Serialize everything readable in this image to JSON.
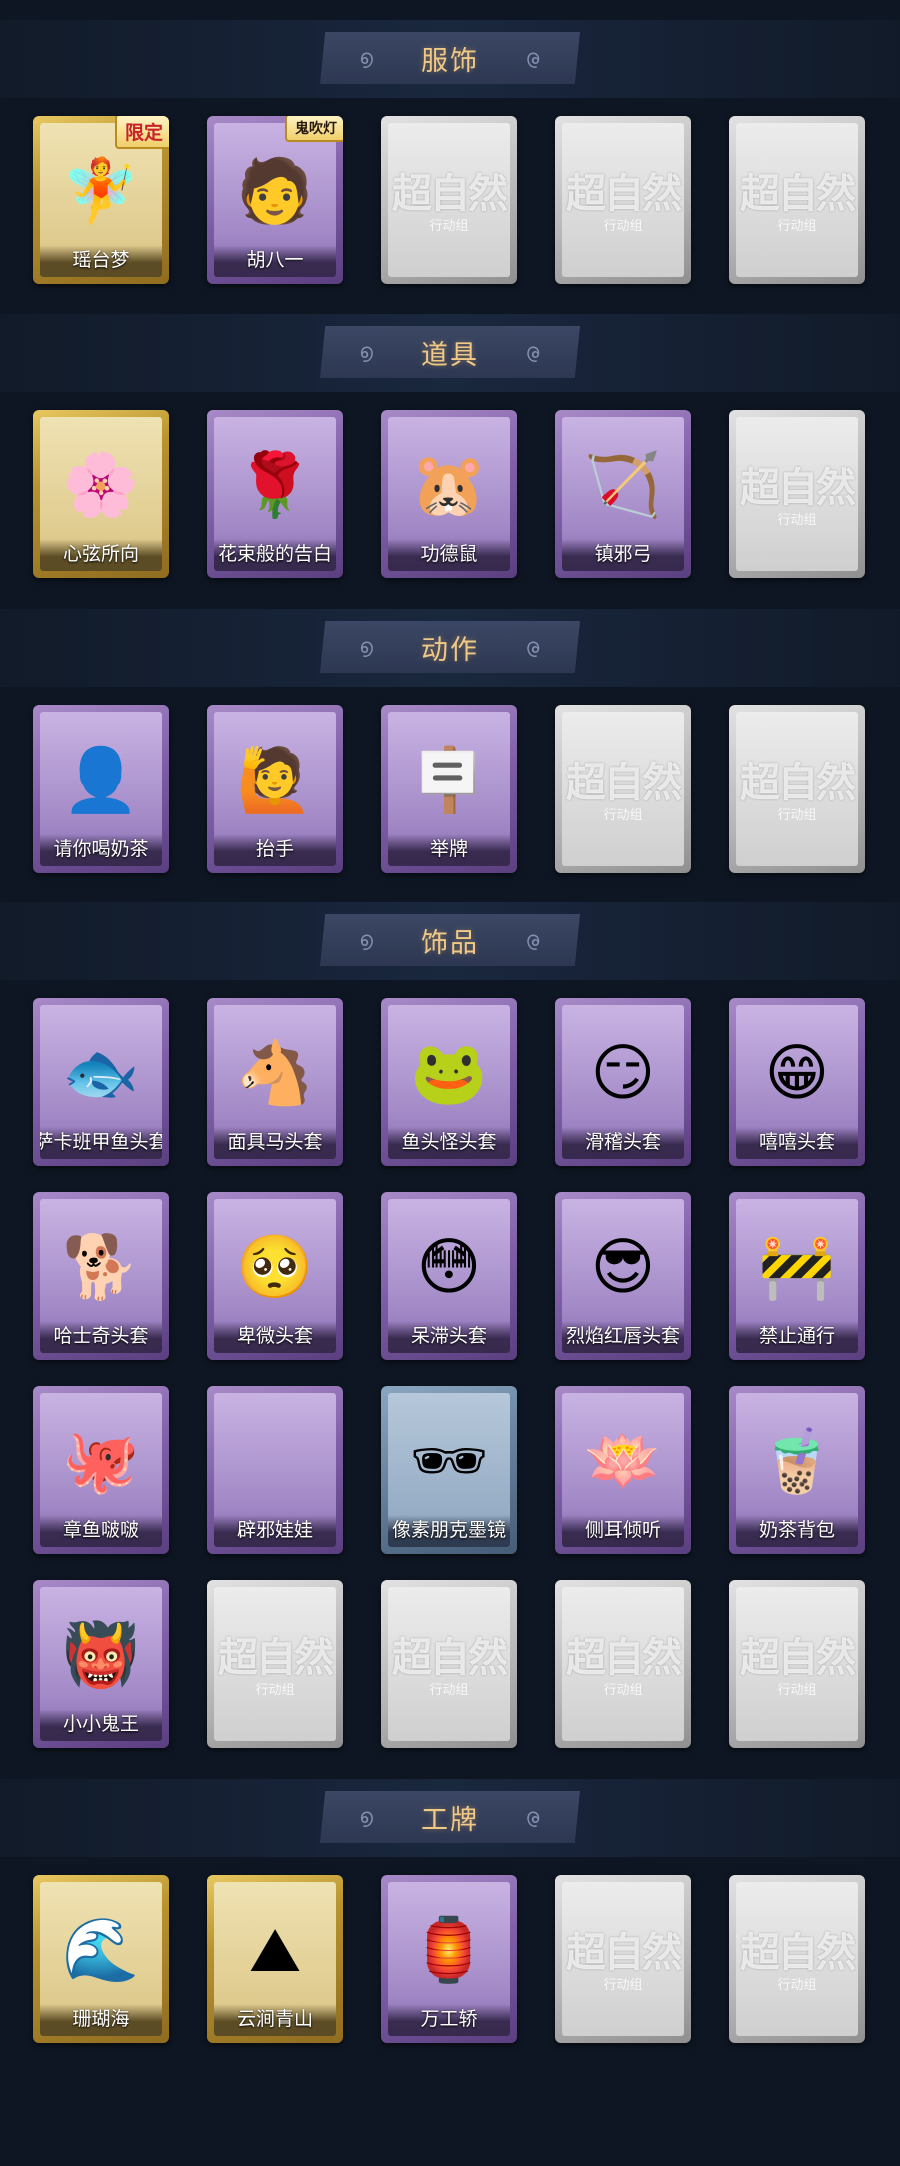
{
  "watermark": {
    "main": "超自然",
    "sub": "行动组"
  },
  "sections": [
    {
      "title": "服饰",
      "cards": [
        {
          "label": "瑶台梦",
          "rarity": "gold",
          "icon": "dress-figure",
          "glyph": "🧚",
          "badge": "限定"
        },
        {
          "label": "胡八一",
          "rarity": "purple",
          "icon": "character-portrait",
          "glyph": "🧑",
          "badge": "鬼吹灯"
        },
        {
          "label": "",
          "rarity": "empty"
        },
        {
          "label": "",
          "rarity": "empty"
        },
        {
          "label": "",
          "rarity": "empty"
        }
      ]
    },
    {
      "title": "道具",
      "cards": [
        {
          "label": "心弦所向",
          "rarity": "gold",
          "icon": "flower-bow",
          "glyph": "🌸"
        },
        {
          "label": "花束般的告白",
          "rarity": "purple",
          "icon": "rose",
          "glyph": "🌹"
        },
        {
          "label": "功德鼠",
          "rarity": "purple",
          "icon": "hamster",
          "glyph": "🐹"
        },
        {
          "label": "镇邪弓",
          "rarity": "purple",
          "icon": "bow",
          "glyph": "🏹"
        },
        {
          "label": "",
          "rarity": "empty"
        }
      ]
    },
    {
      "title": "动作",
      "cards": [
        {
          "label": "请你喝奶茶",
          "rarity": "purple",
          "icon": "person-with-sign",
          "glyph": "👤"
        },
        {
          "label": "抬手",
          "rarity": "purple",
          "icon": "raise-hand",
          "glyph": "🙋"
        },
        {
          "label": "举牌",
          "rarity": "purple",
          "icon": "hold-sign",
          "glyph": "🪧"
        },
        {
          "label": "",
          "rarity": "empty"
        },
        {
          "label": "",
          "rarity": "empty"
        }
      ]
    },
    {
      "title": "饰品",
      "cards": [
        {
          "label": "萨卡班甲鱼头套",
          "rarity": "purple",
          "icon": "fish-head",
          "glyph": "🐟"
        },
        {
          "label": "面具马头套",
          "rarity": "purple",
          "icon": "horse-head",
          "glyph": "🐴"
        },
        {
          "label": "鱼头怪头套",
          "rarity": "purple",
          "icon": "fish-monster",
          "glyph": "🐸"
        },
        {
          "label": "滑稽头套",
          "rarity": "purple",
          "icon": "funny-face",
          "glyph": "😏"
        },
        {
          "label": "嘻嘻头套",
          "rarity": "purple",
          "icon": "grin-face",
          "glyph": "😁"
        },
        {
          "label": "哈士奇头套",
          "rarity": "purple",
          "icon": "husky",
          "glyph": "🐕"
        },
        {
          "label": "卑微头套",
          "rarity": "purple",
          "icon": "humble-face",
          "glyph": "🥺"
        },
        {
          "label": "呆滞头套",
          "rarity": "purple",
          "icon": "dazed-face",
          "glyph": "😳"
        },
        {
          "label": "烈焰红唇头套",
          "rarity": "purple",
          "icon": "pikachu-glasses",
          "glyph": "😎"
        },
        {
          "label": "禁止通行",
          "rarity": "purple",
          "icon": "traffic-cone",
          "glyph": "🚧"
        },
        {
          "label": "章鱼啵啵",
          "rarity": "purple",
          "icon": "octopus",
          "glyph": "🐙"
        },
        {
          "label": "辟邪娃娃",
          "rarity": "purple",
          "icon": "doll",
          "glyph": ""
        },
        {
          "label": "像素朋克墨镜",
          "rarity": "blue",
          "icon": "pixel-sunglasses",
          "glyph": "🕶"
        },
        {
          "label": "侧耳倾听",
          "rarity": "purple",
          "icon": "lotus-wreath",
          "glyph": "🪷"
        },
        {
          "label": "奶茶背包",
          "rarity": "purple",
          "icon": "milk-tea-bag",
          "glyph": "🧋"
        },
        {
          "label": "小小鬼王",
          "rarity": "purple",
          "icon": "chibi-king",
          "glyph": "👹"
        },
        {
          "label": "",
          "rarity": "empty"
        },
        {
          "label": "",
          "rarity": "empty"
        },
        {
          "label": "",
          "rarity": "empty"
        },
        {
          "label": "",
          "rarity": "empty"
        }
      ]
    },
    {
      "title": "工牌",
      "cards": [
        {
          "label": "珊瑚海",
          "rarity": "gold",
          "icon": "ocean-badge",
          "glyph": "🌊"
        },
        {
          "label": "云涧青山",
          "rarity": "gold",
          "icon": "mountain-badge",
          "glyph": "⛰"
        },
        {
          "label": "万工轿",
          "rarity": "purple",
          "icon": "sedan-badge",
          "glyph": "🏮"
        },
        {
          "label": "",
          "rarity": "empty"
        },
        {
          "label": "",
          "rarity": "empty"
        }
      ]
    }
  ]
}
